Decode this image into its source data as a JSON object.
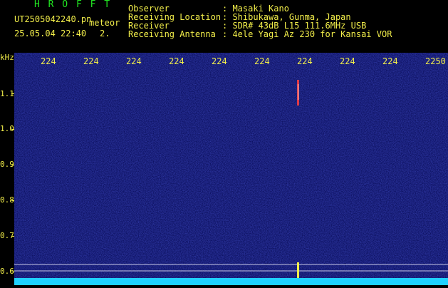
{
  "app": {
    "logo": "H R O F F T",
    "filename": "UT2505042240.pn",
    "tag": "meteor",
    "datetime": "25.05.04 22:40",
    "count": "2."
  },
  "info": [
    {
      "label": "Observer",
      "value": ": Masaki Kano"
    },
    {
      "label": "Receiving Location",
      "value": ": Shibukawa, Gunma, Japan"
    },
    {
      "label": "Receiver",
      "value": ": SDR# 43dB L15 111.6MHz USB"
    },
    {
      "label": "Receiving Antenna",
      "value": ": 4ele Yagi Az 230 for Kansai VOR"
    }
  ],
  "axis": {
    "unit": "kHz",
    "x_ticks": [
      "224",
      "224",
      "224",
      "224",
      "224",
      "224",
      "224",
      "224",
      "224",
      "2250"
    ],
    "y_ticks": [
      "1.1",
      "1.0",
      "0.9",
      "0.8",
      "0.7",
      "0.6"
    ]
  },
  "colors": {
    "background": "#000000",
    "spectrum": "#1a1e8a",
    "label_yellow": "#f2ee4a",
    "logo_green": "#22e822",
    "baseline_cyan": "#20d0ff"
  }
}
